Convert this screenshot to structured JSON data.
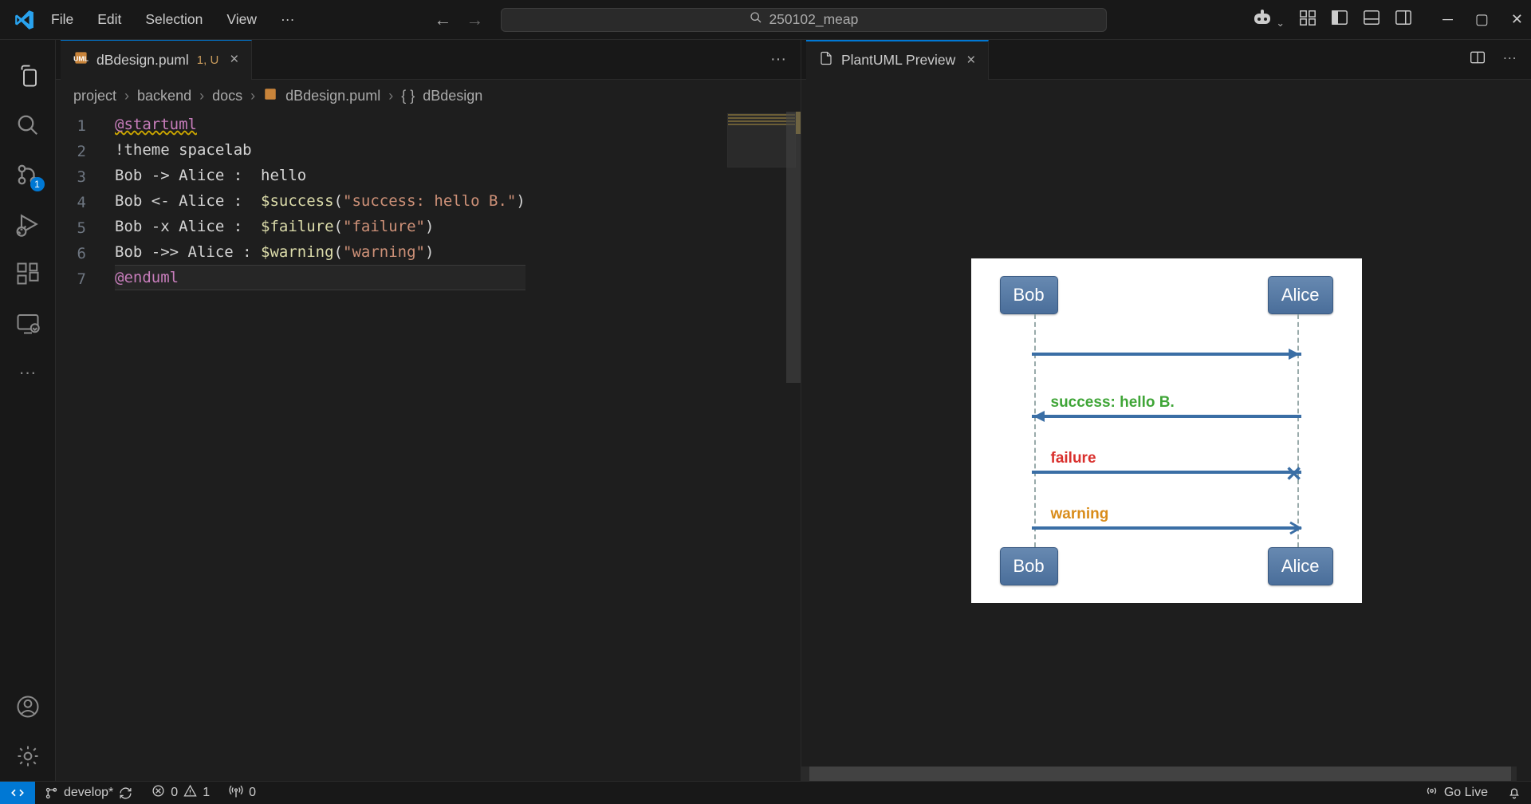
{
  "titlebar": {
    "menu": [
      "File",
      "Edit",
      "Selection",
      "View"
    ],
    "search_text": "250102_meap"
  },
  "activitybar": {
    "scm_badge": "1"
  },
  "editor": {
    "tab": {
      "filename": "dBdesign.puml",
      "modified_indicator": "1, U"
    },
    "breadcrumb": [
      "project",
      "backend",
      "docs",
      "dBdesign.puml",
      "dBdesign"
    ],
    "lines": [
      {
        "n": "1",
        "html": "<span class='tok-dir squiggle'>@startuml</span>"
      },
      {
        "n": "2",
        "html": "<span class='tok-plain'>!theme spacelab</span>"
      },
      {
        "n": "3",
        "html": "<span class='tok-plain'>Bob -> Alice :  hello</span>"
      },
      {
        "n": "4",
        "html": "<span class='tok-plain'>Bob <- Alice :  </span><span class='tok-fn'>$success</span><span class='tok-plain'>(</span><span class='tok-str'>\"success: hello B.\"</span><span class='tok-plain'>)</span>"
      },
      {
        "n": "5",
        "html": "<span class='tok-plain'>Bob -x Alice :  </span><span class='tok-fn'>$failure</span><span class='tok-plain'>(</span><span class='tok-str'>\"failure\"</span><span class='tok-plain'>)</span>"
      },
      {
        "n": "6",
        "html": "<span class='tok-plain'>Bob ->> Alice : </span><span class='tok-fn'>$warning</span><span class='tok-plain'>(</span><span class='tok-str'>\"warning\"</span><span class='tok-plain'>)</span>"
      },
      {
        "n": "7",
        "html": "<span class='tok-dir'>@enduml</span>"
      }
    ],
    "current_line": 7
  },
  "preview": {
    "tab_title": "PlantUML Preview",
    "diagram": {
      "actors": [
        "Bob",
        "Alice"
      ],
      "messages": [
        {
          "label": "",
          "dir": "right",
          "style": "solid",
          "cls": ""
        },
        {
          "label": "success: hello B.",
          "dir": "left",
          "style": "solid",
          "cls": "lbl-success"
        },
        {
          "label": "failure",
          "dir": "x",
          "style": "solid",
          "cls": "lbl-failure"
        },
        {
          "label": "warning",
          "dir": "right-open",
          "style": "solid",
          "cls": "lbl-warning"
        }
      ]
    }
  },
  "statusbar": {
    "branch": "develop*",
    "errors": "0",
    "warnings": "1",
    "ports": "0",
    "go_live": "Go Live"
  }
}
